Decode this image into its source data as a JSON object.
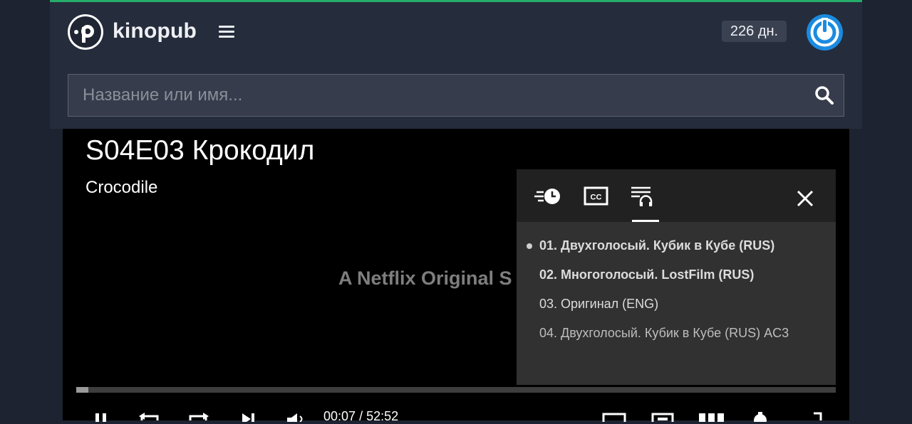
{
  "header": {
    "brand": "kinopub",
    "days_left": "226 дн.",
    "accent_color": "#25ad6a"
  },
  "search": {
    "placeholder": "Название или имя...",
    "value": ""
  },
  "player": {
    "title": "S04E03 Крокодил",
    "subtitle": "Crocodile",
    "watermark": "A Netflix Original S",
    "progress": 0.016,
    "time_current": "00:07",
    "time_separator": "/",
    "time_total": "52:52"
  },
  "settings_panel": {
    "tabs": [
      {
        "icon": "speed-icon"
      },
      {
        "icon": "subtitles-icon"
      },
      {
        "icon": "audio-tracks-icon",
        "active": true
      }
    ],
    "tracks": [
      {
        "label": "01. Двухголосый. Кубик в Кубе (RUS)",
        "selected": true,
        "bold": true
      },
      {
        "label": "02. Многоголосый. LostFilm (RUS)",
        "selected": false,
        "bold": true
      },
      {
        "label": "03. Оригинал (ENG)",
        "selected": false,
        "bold": false
      },
      {
        "label": "04. Двухголосый. Кубик в Кубе (RUS) AC3",
        "selected": false,
        "bold": false
      }
    ]
  }
}
